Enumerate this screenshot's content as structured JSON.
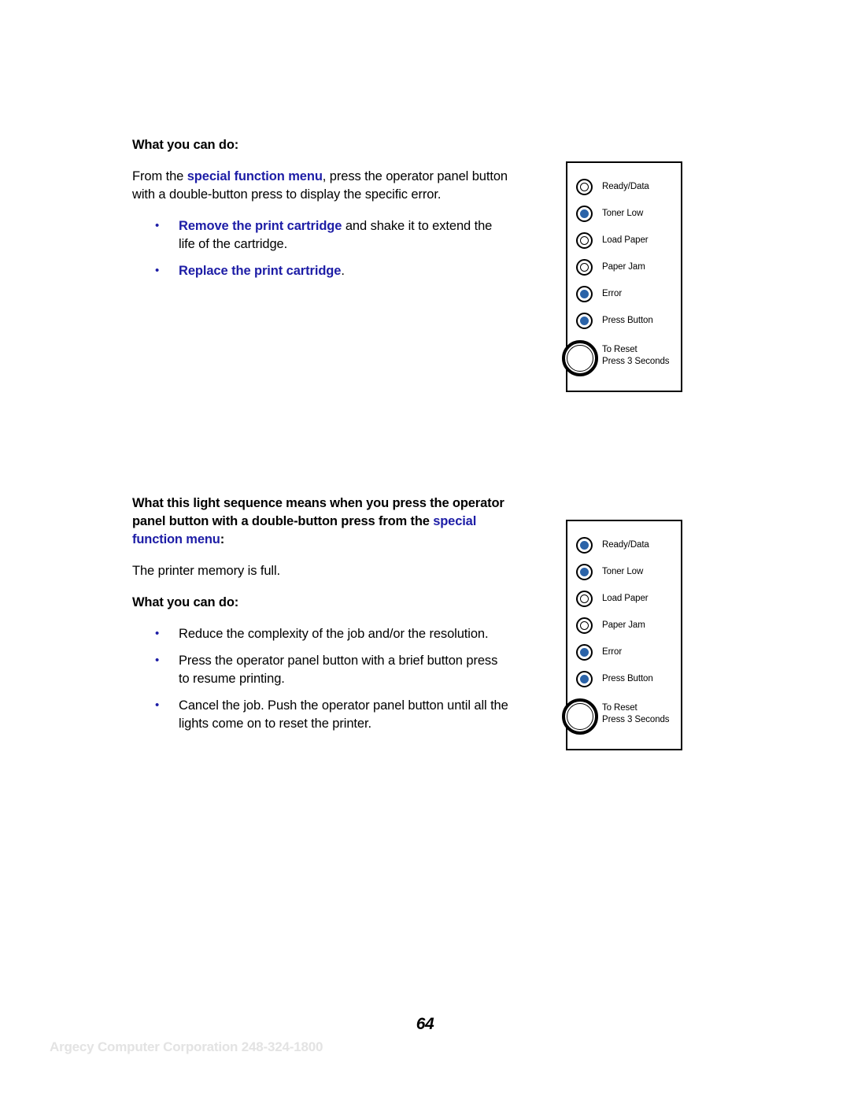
{
  "section1": {
    "heading": "What you can do:",
    "paragraph": {
      "before": "From the ",
      "link": "special function menu",
      "after": ", press the operator panel button with a double-button press to display the specific error."
    },
    "bullets": [
      {
        "bold": "Remove the print cartridge",
        "rest": " and shake it to extend the life of the cartridge."
      },
      {
        "bold": "Replace the print cartridge",
        "rest": "."
      }
    ]
  },
  "section2": {
    "heading": {
      "before": "What this light sequence means when you press the operator panel button with a double-button press from the ",
      "link": "special function menu",
      "after": ":"
    },
    "meaning": "The printer memory is full.",
    "subheading": "What you can do:",
    "bullets": [
      {
        "bold": "",
        "rest": "Reduce the complexity of the job and/or the resolution."
      },
      {
        "bold": "",
        "rest": "Press the operator panel button with a brief button press to resume printing."
      },
      {
        "bold": "",
        "rest": "Cancel the job. Push the operator panel button until all the lights come on to reset the printer."
      }
    ]
  },
  "panel1": {
    "leds": [
      {
        "label": "Ready/Data",
        "on": false
      },
      {
        "label": "Toner Low",
        "on": true
      },
      {
        "label": "Load Paper",
        "on": false
      },
      {
        "label": "Paper Jam",
        "on": false
      },
      {
        "label": "Error",
        "on": true
      },
      {
        "label": "Press Button",
        "on": true
      }
    ],
    "reset_line1": "To Reset",
    "reset_line2": "Press 3 Seconds"
  },
  "panel2": {
    "leds": [
      {
        "label": "Ready/Data",
        "on": true
      },
      {
        "label": "Toner Low",
        "on": true
      },
      {
        "label": "Load Paper",
        "on": false
      },
      {
        "label": "Paper Jam",
        "on": false
      },
      {
        "label": "Error",
        "on": true
      },
      {
        "label": "Press Button",
        "on": true
      }
    ],
    "reset_line1": "To Reset",
    "reset_line2": "Press 3 Seconds"
  },
  "footer": {
    "page_number": "64",
    "credit": "Argecy Computer Corporation 248-324-1800"
  },
  "colors": {
    "link_blue": "#1d1da6",
    "led_blue": "#2b63a8",
    "credit_gray": "#e3e3e3"
  }
}
